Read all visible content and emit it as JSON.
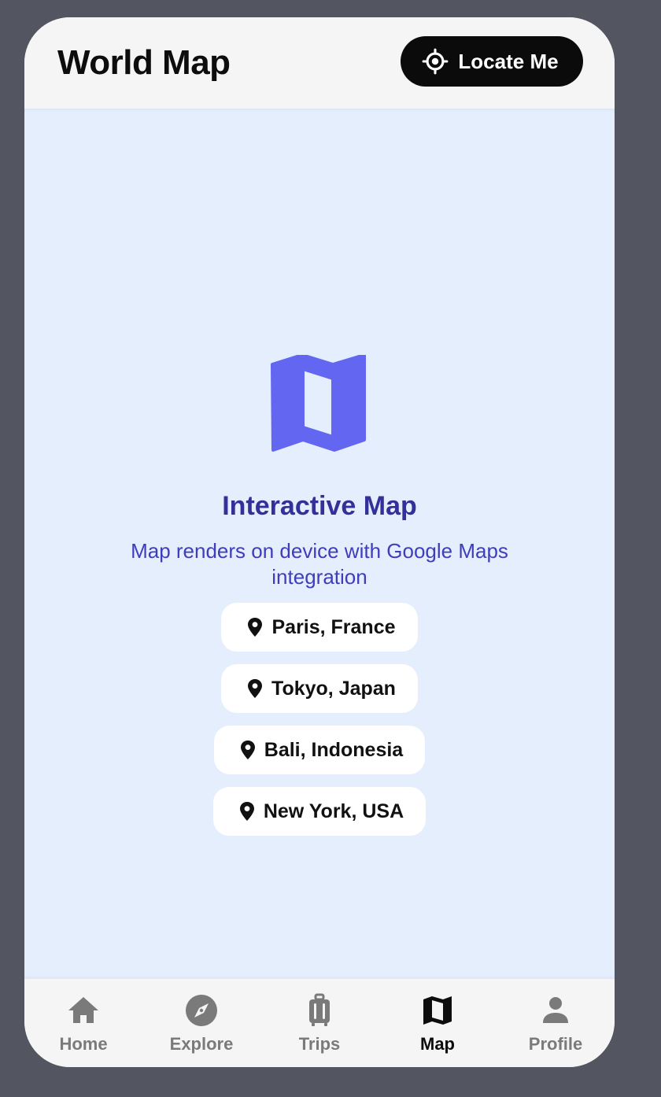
{
  "header": {
    "title": "World Map",
    "locate_label": "Locate Me"
  },
  "map": {
    "title": "Interactive Map",
    "subtitle": "Map renders on device with Google Maps integration",
    "locations": [
      {
        "label": "Paris, France"
      },
      {
        "label": "Tokyo, Japan"
      },
      {
        "label": "Bali, Indonesia"
      },
      {
        "label": "New York, USA"
      }
    ]
  },
  "tabs": [
    {
      "label": "Home",
      "icon": "home-icon",
      "active": false
    },
    {
      "label": "Explore",
      "icon": "compass-icon",
      "active": false
    },
    {
      "label": "Trips",
      "icon": "luggage-icon",
      "active": false
    },
    {
      "label": "Map",
      "icon": "map-icon",
      "active": true
    },
    {
      "label": "Profile",
      "icon": "person-icon",
      "active": false
    }
  ],
  "colors": {
    "accent": "#6366f1",
    "map_background": "#e4eefd",
    "title_color": "#33309a"
  }
}
